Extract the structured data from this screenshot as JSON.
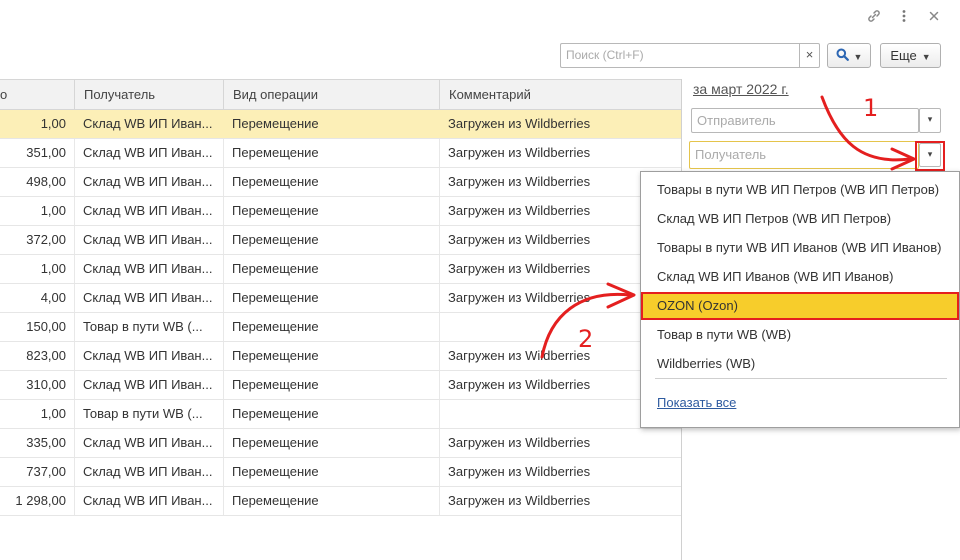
{
  "window": {
    "link_icon": "link-icon",
    "more_icon": "more-vertical-icon",
    "close_icon": "close-icon"
  },
  "toolbar": {
    "search_placeholder": "Поиск (Ctrl+F)",
    "clear_label": "×",
    "search_icon": "search-icon",
    "more_label": "Еще"
  },
  "table": {
    "columns": {
      "number": "о",
      "recipient": "Получатель",
      "operation": "Вид операции",
      "comment": "Комментарий"
    },
    "rows": [
      {
        "value": "1,00",
        "recipient": "Склад WB ИП Иван...",
        "operation": "Перемещение",
        "comment": "Загружен из Wildberries"
      },
      {
        "value": "351,00",
        "recipient": "Склад WB ИП Иван...",
        "operation": "Перемещение",
        "comment": "Загружен из Wildberries"
      },
      {
        "value": "498,00",
        "recipient": "Склад WB ИП Иван...",
        "operation": "Перемещение",
        "comment": "Загружен из Wildberries"
      },
      {
        "value": "1,00",
        "recipient": "Склад WB ИП Иван...",
        "operation": "Перемещение",
        "comment": "Загружен из Wildberries"
      },
      {
        "value": "372,00",
        "recipient": "Склад WB ИП Иван...",
        "operation": "Перемещение",
        "comment": "Загружен из Wildberries"
      },
      {
        "value": "1,00",
        "recipient": "Склад WB ИП Иван...",
        "operation": "Перемещение",
        "comment": "Загружен из Wildberries"
      },
      {
        "value": "4,00",
        "recipient": "Склад WB ИП Иван...",
        "operation": "Перемещение",
        "comment": "Загружен из Wildberries"
      },
      {
        "value": "150,00",
        "recipient": "Товар в пути WB (...",
        "operation": "Перемещение",
        "comment": ""
      },
      {
        "value": "823,00",
        "recipient": "Склад WB ИП Иван...",
        "operation": "Перемещение",
        "comment": "Загружен из Wildberries"
      },
      {
        "value": "310,00",
        "recipient": "Склад WB ИП Иван...",
        "operation": "Перемещение",
        "comment": "Загружен из Wildberries"
      },
      {
        "value": "1,00",
        "recipient": "Товар в пути WB (...",
        "operation": "Перемещение",
        "comment": ""
      },
      {
        "value": "335,00",
        "recipient": "Склад WB ИП Иван...",
        "operation": "Перемещение",
        "comment": "Загружен из Wildberries"
      },
      {
        "value": "737,00",
        "recipient": "Склад WB ИП Иван...",
        "operation": "Перемещение",
        "comment": "Загружен из Wildberries"
      },
      {
        "value": "1 298,00",
        "recipient": "Склад WB ИП Иван...",
        "operation": "Перемещение",
        "comment": "Загружен из Wildberries"
      }
    ]
  },
  "filters": {
    "period": "за март 2022 г.",
    "sender_placeholder": "Отправитель",
    "recipient_placeholder": "Получатель",
    "dropdown_caret": "▾"
  },
  "dropdown": {
    "items": [
      "Товары в пути WB ИП Петров (WB ИП Петров)",
      "Склад WB ИП Петров (WB ИП Петров)",
      "Товары в пути WB ИП Иванов (WB ИП Иванов)",
      "Склад WB ИП Иванов (WB ИП Иванов)",
      "OZON (Ozon)",
      "Товар в пути WB (WB)",
      "Wildberries (WB)"
    ],
    "highlighted_index": 4,
    "show_all": "Показать все"
  },
  "annotations": {
    "step1": "1",
    "step2": "2"
  },
  "colors": {
    "selected_row": "#fcefb7",
    "highlight": "#f7cd2b",
    "annotation_red": "#e41f1f",
    "link": "#2e5ba0"
  }
}
